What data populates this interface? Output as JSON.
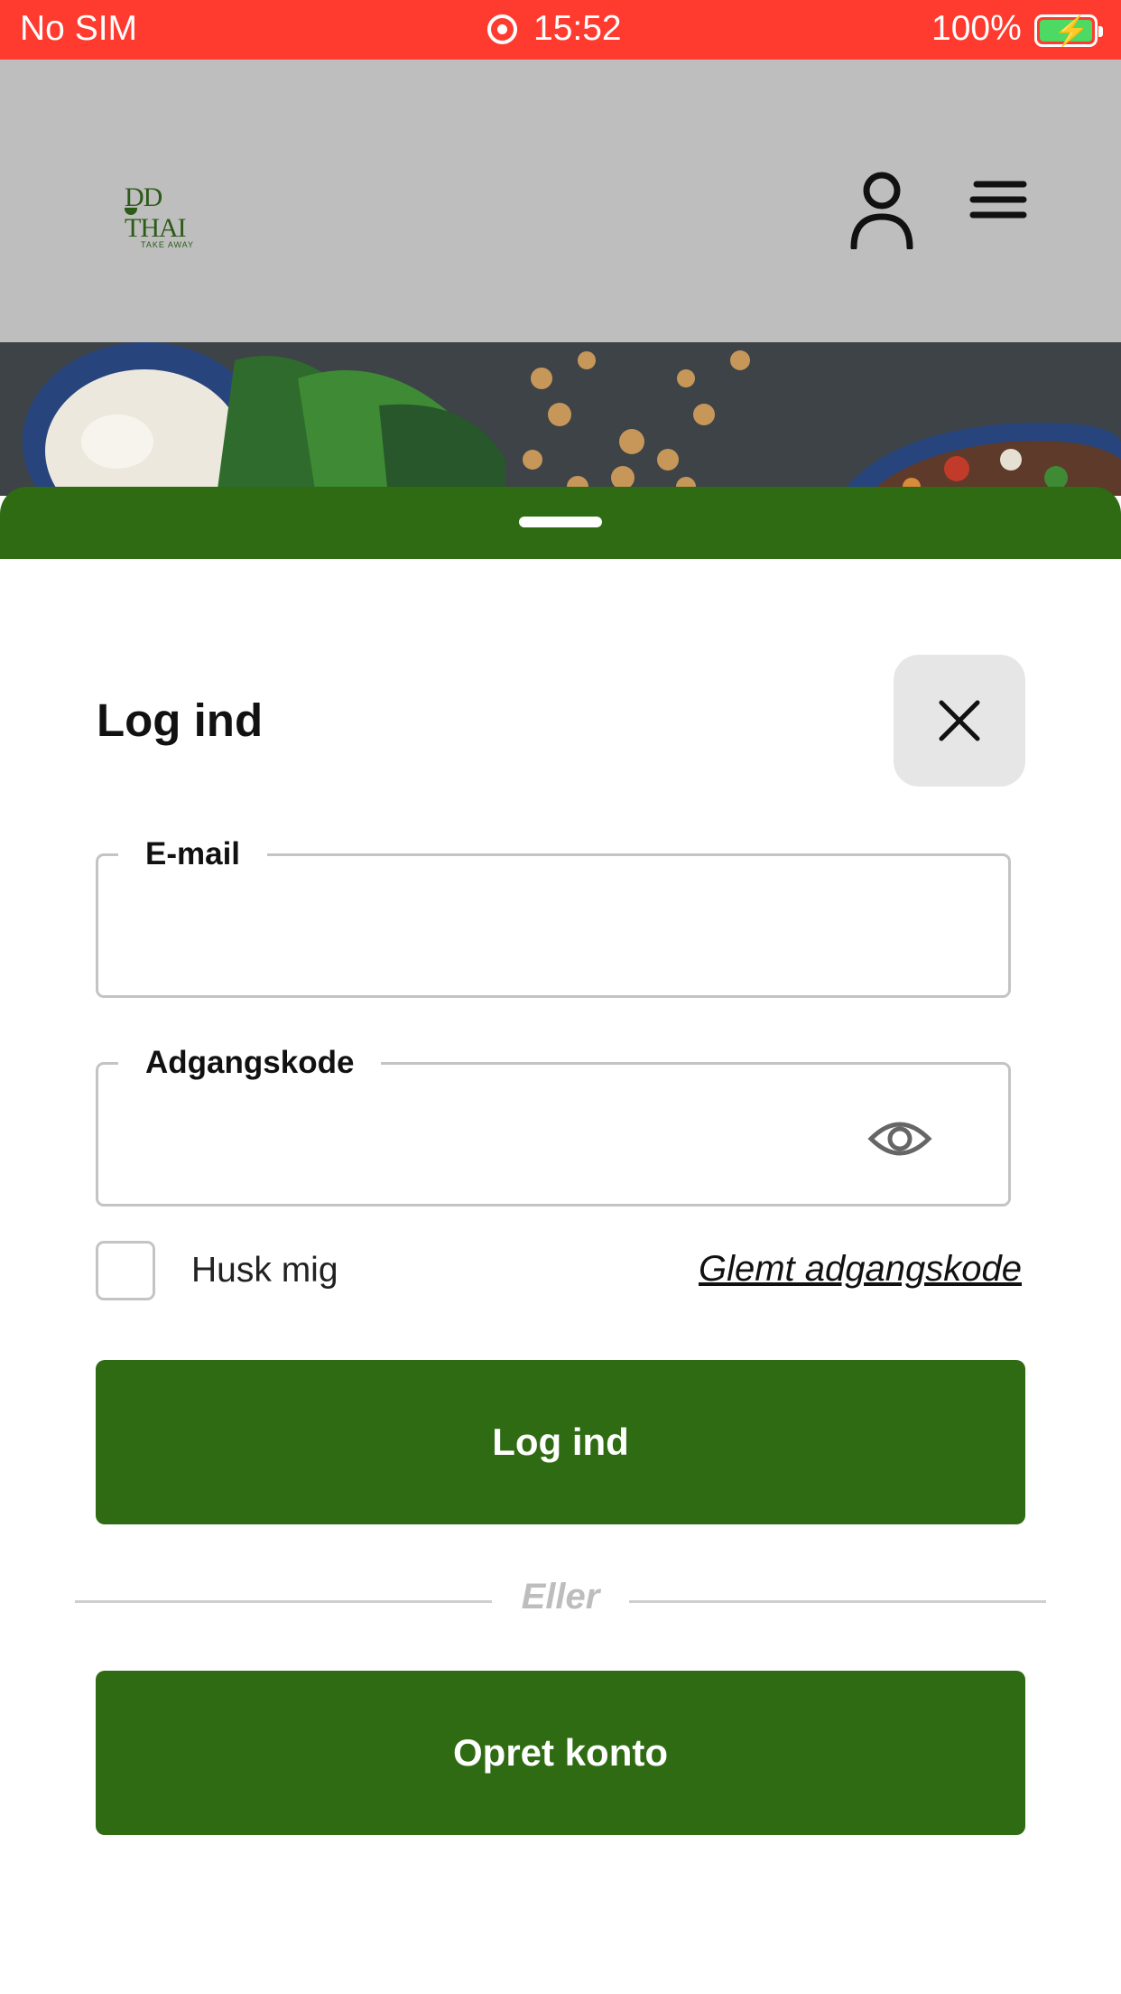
{
  "status_bar": {
    "carrier": "No SIM",
    "time": "15:52",
    "battery": "100%",
    "battery_level": 1.0,
    "colors": {
      "background": "#ff3b30",
      "battery_fill": "#4cd964"
    }
  },
  "header": {
    "logo": {
      "name": "DD THAI",
      "tagline": "TAKE AWAY"
    },
    "icons": {
      "account": "user-icon",
      "menu": "hamburger-menu-icon"
    }
  },
  "login": {
    "title": "Log ind",
    "email_label": "E-mail",
    "email_value": "",
    "password_label": "Adgangskode",
    "password_value": "",
    "remember_label": "Husk mig",
    "remember_checked": false,
    "forgot_label": "Glemt adgangskode",
    "submit_label": "Log ind",
    "divider_label": "Eller",
    "create_label": "Opret konto"
  },
  "colors": {
    "accent": "#2e6b12",
    "header_bg": "#bebebe",
    "close_bg": "#e6e6e6"
  }
}
